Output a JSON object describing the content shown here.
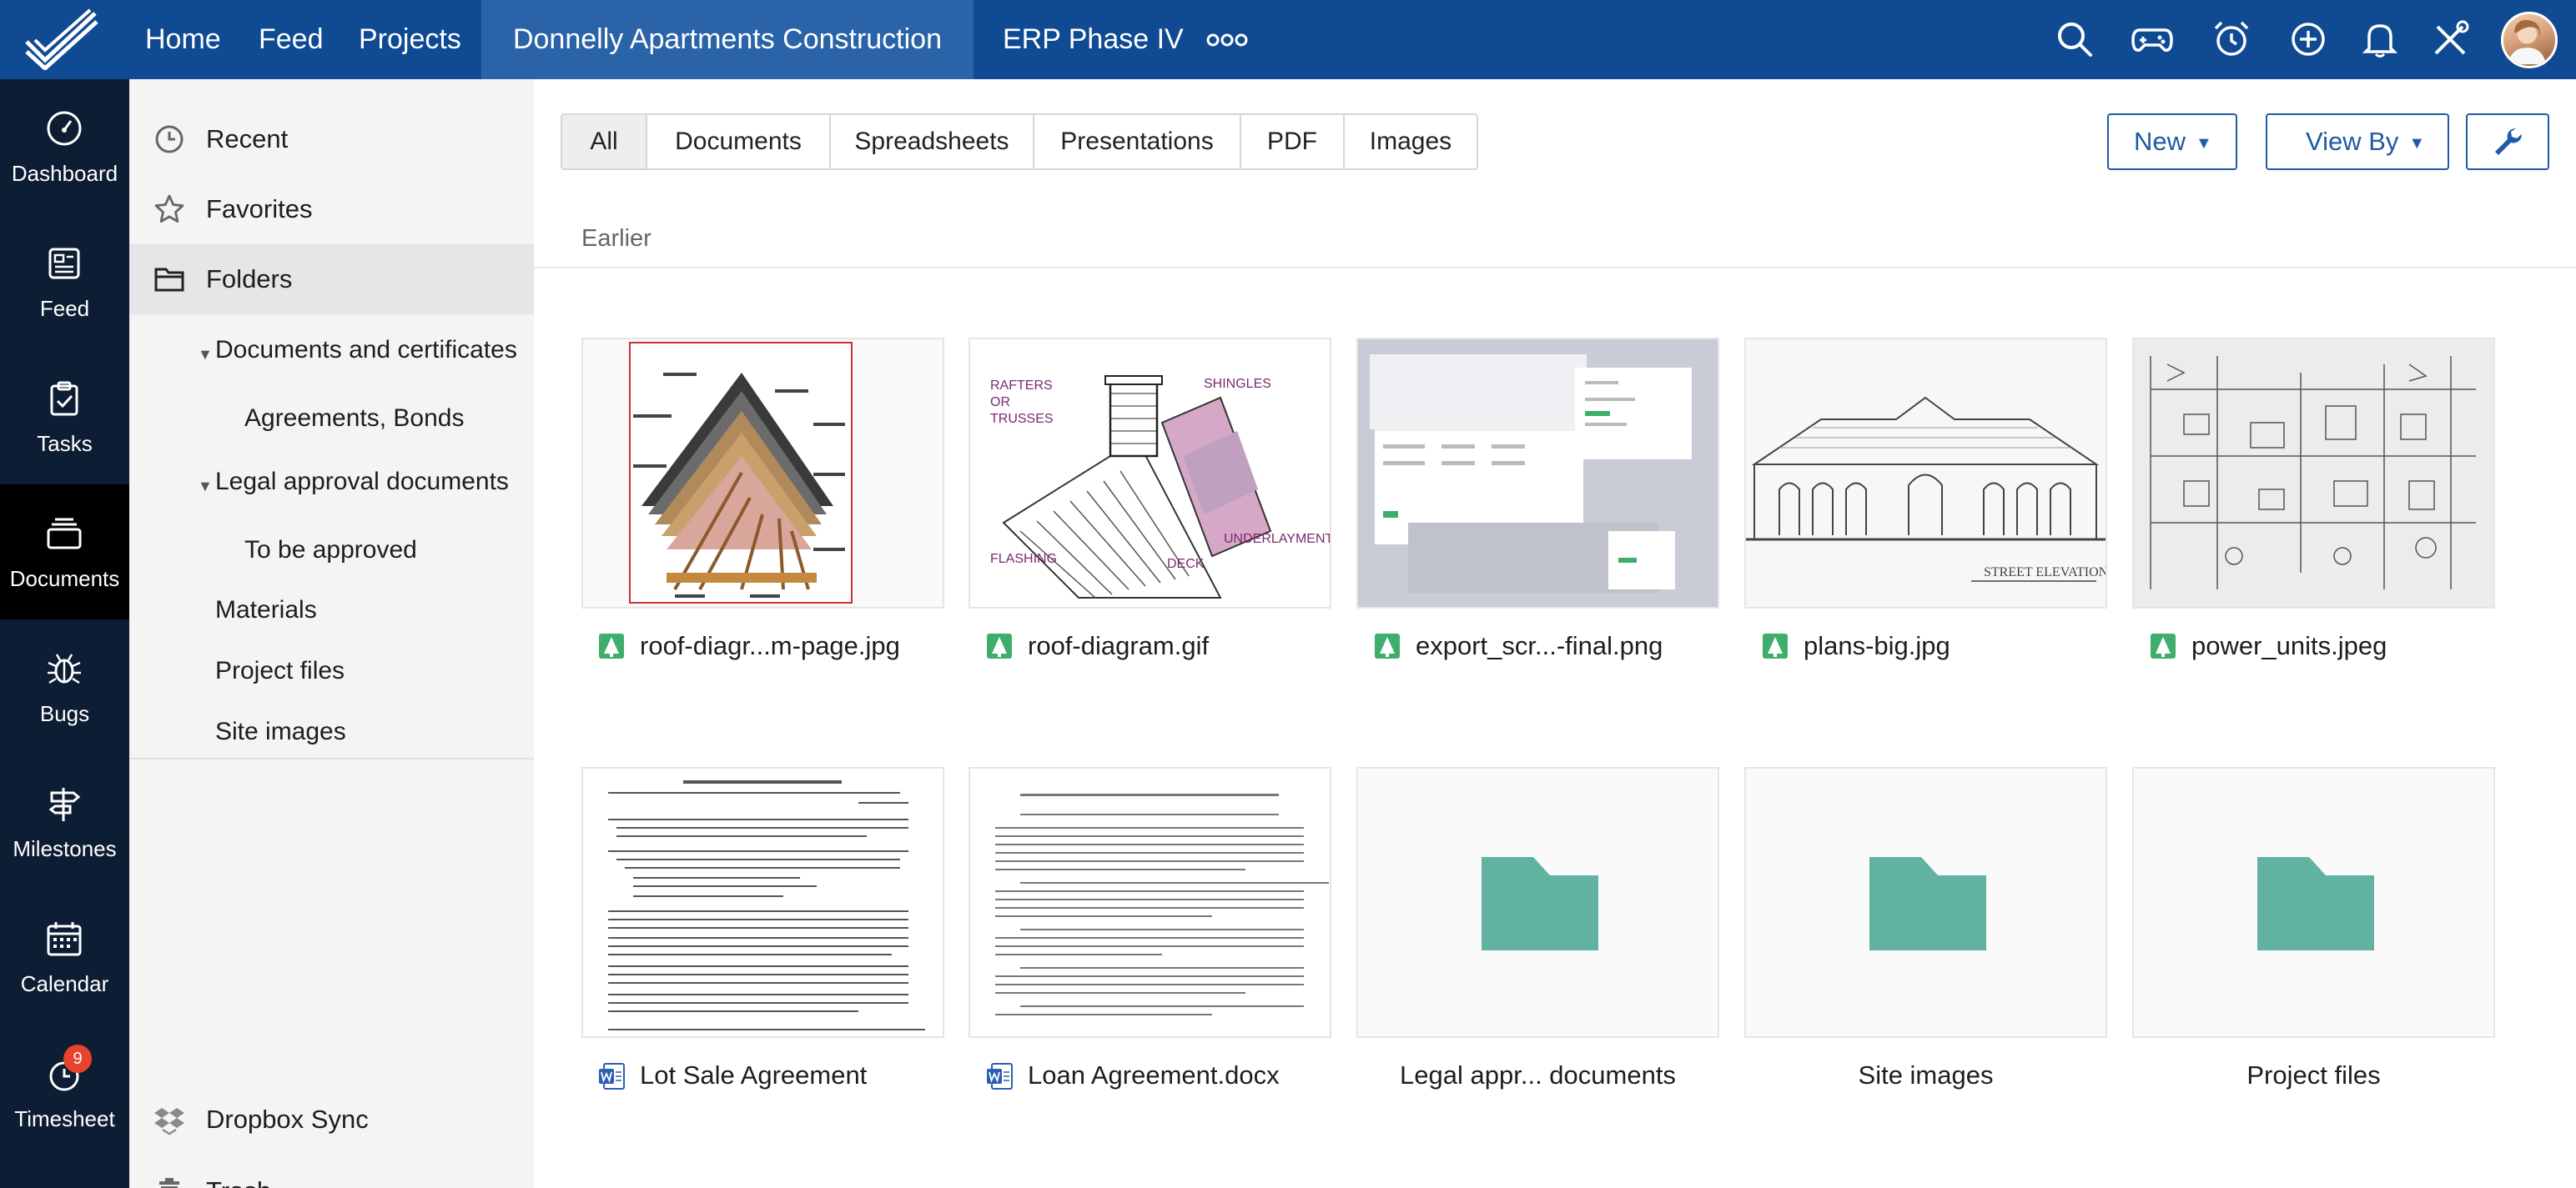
{
  "topnav": {
    "items": [
      "Home",
      "Feed",
      "Projects"
    ],
    "active_project": "Donnelly Apartments Construction",
    "other_project": "ERP Phase IV"
  },
  "rail": {
    "items": [
      "Dashboard",
      "Feed",
      "Tasks",
      "Documents",
      "Bugs",
      "Milestones",
      "Calendar",
      "Timesheet"
    ],
    "active": "Documents",
    "timesheet_badge": "9"
  },
  "panel": {
    "recent": "Recent",
    "favorites": "Favorites",
    "folders": "Folders",
    "tree": {
      "docs_certs": "Documents and certificates",
      "agreements": "Agreements, Bonds",
      "legal": "Legal approval documents",
      "to_approve": "To be approved",
      "materials": "Materials",
      "project_files": "Project files",
      "site_images": "Site images"
    },
    "dropbox": "Dropbox Sync",
    "trash": "Trash"
  },
  "filters": {
    "tabs": [
      "All",
      "Documents",
      "Spreadsheets",
      "Presentations",
      "PDF",
      "Images"
    ],
    "active": "All"
  },
  "actions": {
    "new": "New",
    "view_by": "View By"
  },
  "section": {
    "title": "Earlier"
  },
  "files": {
    "row1": [
      "roof-diagr...m-page.jpg",
      "roof-diagram.gif",
      "export_scr...-final.png",
      "plans-big.jpg",
      "power_units.jpeg"
    ],
    "row2": [
      "Lot Sale Agreement",
      "Loan Agreement.docx",
      "Legal appr... documents",
      "Site images",
      "Project files"
    ]
  },
  "thumb_text": {
    "rafters": "RAFTERS",
    "or": "OR",
    "trusses": "TRUSSES",
    "shingles": "SHINGLES",
    "underlayment": "UNDERLAYMENT",
    "flashing": "FLASHING",
    "deck": "DECK",
    "street_elevation": "STREET ELEVATION"
  },
  "colors": {
    "topbar": "#0f4a93",
    "rail": "#0d1d33",
    "accent": "#1f5aa6",
    "folder": "#62b2a1",
    "badge": "#e8432d"
  }
}
